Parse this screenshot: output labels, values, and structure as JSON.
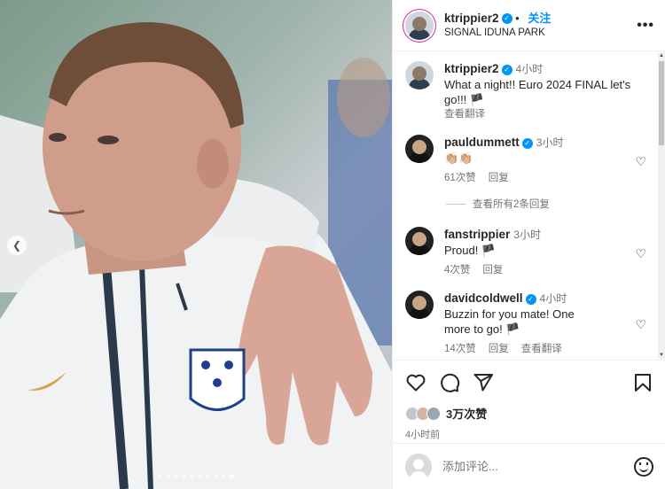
{
  "post": {
    "author": "ktrippier2",
    "follow_label": "关注",
    "location": "SIGNAL IDUNA PARK",
    "more_label": "•••"
  },
  "comments": [
    {
      "user": "ktrippier2",
      "verified": true,
      "time": "4小时",
      "text": "What a night!! Euro 2024 FINAL let's go!!! 🏴",
      "translate": "查看翻译"
    },
    {
      "user": "pauldummett",
      "verified": true,
      "time": "3小时",
      "text": "👏🏼👏🏼",
      "likes": "61次赞",
      "reply": "回复",
      "view_replies": "查看所有2条回复"
    },
    {
      "user": "fanstrippier",
      "verified": false,
      "time": "3小时",
      "text": "Proud! 🏴",
      "likes": "4次赞",
      "reply": "回复"
    },
    {
      "user": "davidcoldwell",
      "verified": true,
      "time": "4小时",
      "text": "Buzzin for you mate! One more to go! 🏴",
      "likes": "14次赞",
      "reply": "回复",
      "translate": "查看翻译"
    }
  ],
  "engagement": {
    "likes": "3万次赞",
    "posted": "4小时前"
  },
  "add_comment": {
    "placeholder": "添加评论..."
  },
  "icons": {
    "like": "heart-icon",
    "comment": "comment-icon",
    "share": "share-icon",
    "save": "bookmark-icon",
    "emoji": "emoji-icon",
    "prev": "chevron-left-icon"
  },
  "colors": {
    "accent": "#0095f6",
    "text": "#262626",
    "muted": "#737373"
  }
}
